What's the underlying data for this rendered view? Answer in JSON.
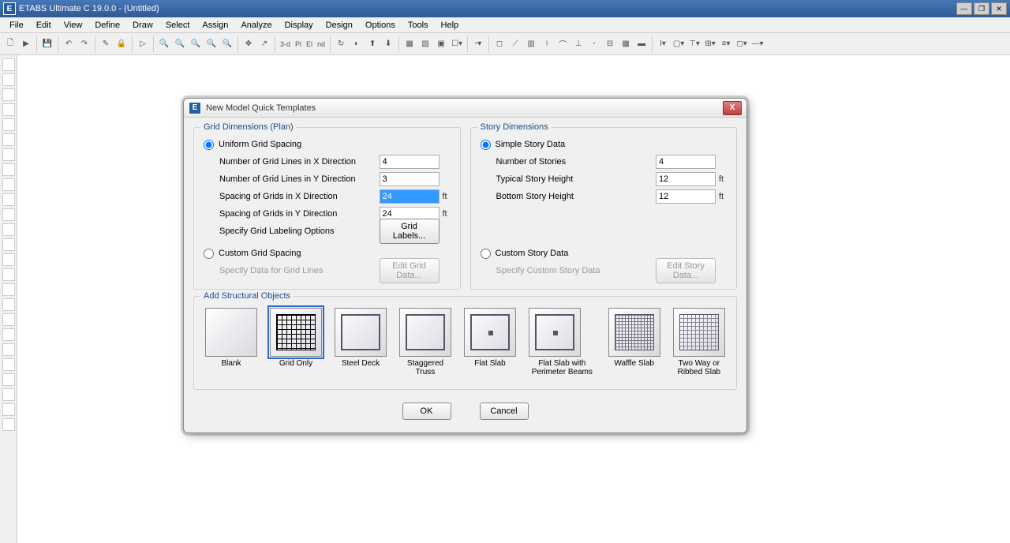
{
  "app": {
    "title": "ETABS Ultimate C 19.0.0 - (Untitled)",
    "icon_letter": "E"
  },
  "menu": [
    "File",
    "Edit",
    "View",
    "Define",
    "Draw",
    "Select",
    "Assign",
    "Analyze",
    "Display",
    "Design",
    "Options",
    "Tools",
    "Help"
  ],
  "toolbar_text": [
    "3-d",
    "Pl",
    "El",
    "nd"
  ],
  "dialog": {
    "title": "New Model Quick Templates",
    "grid_section": "Grid Dimensions (Plan)",
    "story_section": "Story Dimensions",
    "uniform_grid": "Uniform Grid Spacing",
    "custom_grid": "Custom Grid Spacing",
    "simple_story": "Simple Story Data",
    "custom_story": "Custom Story Data",
    "num_x_label": "Number of Grid Lines in X Direction",
    "num_y_label": "Number of Grid Lines in Y Direction",
    "sp_x_label": "Spacing of Grids in X Direction",
    "sp_y_label": "Spacing of Grids in Y Direction",
    "label_opts": "Specify Grid Labeling Options",
    "grid_labels_btn": "Grid Labels...",
    "specify_lines": "Specify Data for Grid Lines",
    "edit_grid_btn": "Edit Grid Data...",
    "num_stories_label": "Number of Stories",
    "typ_height_label": "Typical Story Height",
    "bot_height_label": "Bottom Story Height",
    "specify_story": "Specify Custom Story Data",
    "edit_story_btn": "Edit Story Data...",
    "unit_ft": "ft",
    "values": {
      "num_x": "4",
      "num_y": "3",
      "sp_x": "24",
      "sp_y": "24",
      "num_stories": "4",
      "typ_height": "12",
      "bot_height": "12"
    },
    "struct_section": "Add Structural Objects",
    "templates": [
      "Blank",
      "Grid Only",
      "Steel Deck",
      "Staggered Truss",
      "Flat Slab",
      "Flat Slab with Perimeter Beams",
      "Waffle Slab",
      "Two Way or Ribbed Slab"
    ],
    "ok": "OK",
    "cancel": "Cancel"
  }
}
